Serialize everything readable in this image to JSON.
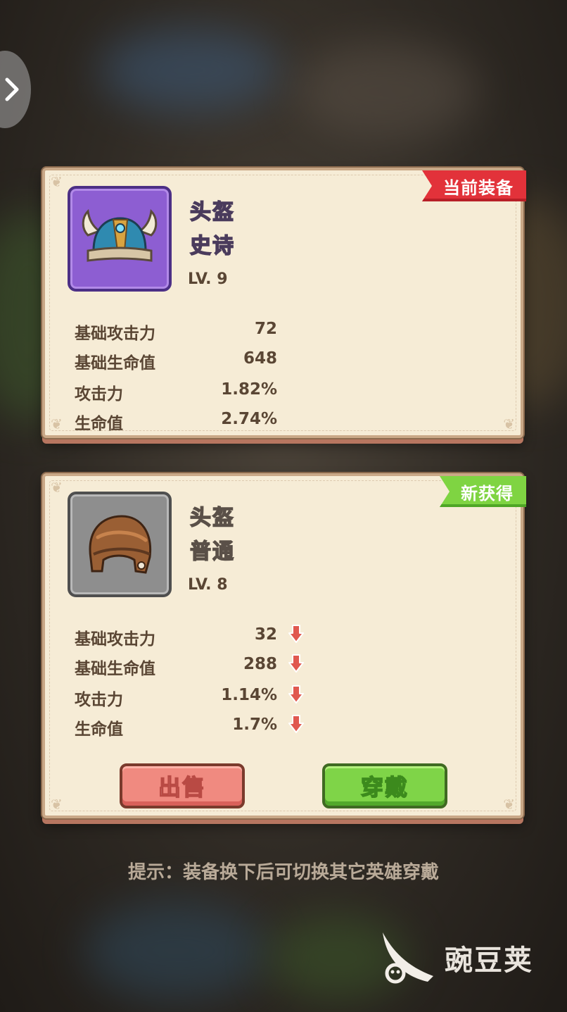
{
  "current_card": {
    "badge": "当前装备",
    "item_name": "头盔",
    "rarity": "史诗",
    "level": "LV. 9",
    "item_icon": "viking-helmet-icon",
    "stats": [
      {
        "label": "基础攻击力",
        "value": "72"
      },
      {
        "label": "基础生命值",
        "value": "648"
      },
      {
        "label": "攻击力",
        "value": "1.82%"
      },
      {
        "label": "生命值",
        "value": "2.74%"
      }
    ]
  },
  "new_card": {
    "badge": "新获得",
    "item_name": "头盔",
    "rarity": "普通",
    "level": "LV. 8",
    "item_icon": "leather-helmet-icon",
    "stats": [
      {
        "label": "基础攻击力",
        "value": "32",
        "trend": "down"
      },
      {
        "label": "基础生命值",
        "value": "288",
        "trend": "down"
      },
      {
        "label": "攻击力",
        "value": "1.14%",
        "trend": "down"
      },
      {
        "label": "生命值",
        "value": "1.7%",
        "trend": "down"
      }
    ],
    "sell_label": "出售",
    "equip_label": "穿戴"
  },
  "tip": "提示：装备换下后可切换其它英雄穿戴",
  "watermark": "豌豆荚",
  "colors": {
    "current_badge": "#e2323a",
    "new_badge": "#7fd442",
    "epic_frame": "#8d5ed2",
    "common_frame": "#8e8e8e",
    "sell_button": "#f08a80",
    "equip_button": "#7fd448",
    "down_arrow": "#e0584f"
  }
}
